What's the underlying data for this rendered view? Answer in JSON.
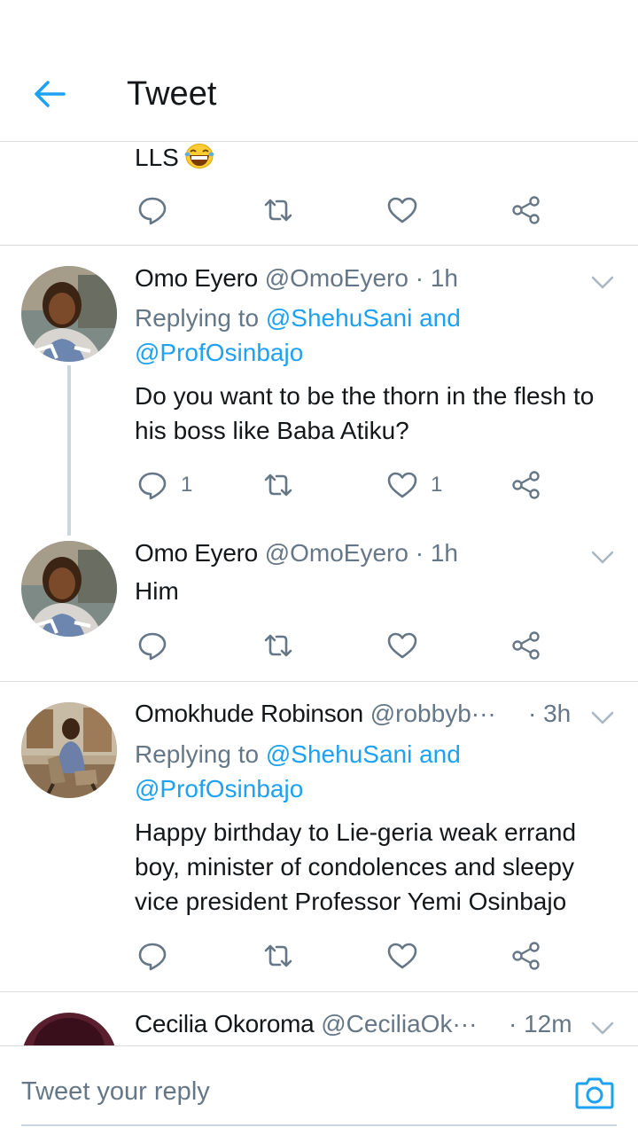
{
  "header": {
    "title": "Tweet",
    "back_icon": "back-arrow-icon",
    "accent_color": "#1da1f2"
  },
  "snippet": {
    "text": "LLS",
    "emoji": "laughing-tears-emoji"
  },
  "tweets": [
    {
      "name": "Omo Eyero",
      "handle": "@OmoEyero",
      "time": "· 1h",
      "replying_prefix": "Replying to",
      "mention_1": "@ShehuSani",
      "mention_join": "and",
      "mention_2": "@ProfOsinbajo",
      "text_lines": [
        "Do you want to be the thorn in the flesh to",
        "his boss like Baba Atiku?"
      ],
      "reply_count": "1",
      "like_count": "1"
    },
    {
      "name": "Omo Eyero",
      "handle": "@OmoEyero",
      "time": "· 1h",
      "text_lines": [
        "Him"
      ]
    },
    {
      "name": "Omokhude Robinson",
      "handle": "@robbyb···",
      "time": "· 3h",
      "replying_prefix": "Replying to",
      "mention_1": "@ShehuSani",
      "mention_join": "and",
      "mention_2": "@ProfOsinbajo",
      "text_lines": [
        "Happy birthday to Lie-geria weak errand",
        "boy, minister of condolences and sleepy",
        "vice president Professor Yemi Osinbajo"
      ]
    },
    {
      "name": "Cecilia Okoroma",
      "handle": "@CeciliaOk···",
      "time": "· 12m"
    }
  ],
  "compose": {
    "placeholder": "Tweet your reply",
    "camera_icon": "camera-icon"
  }
}
